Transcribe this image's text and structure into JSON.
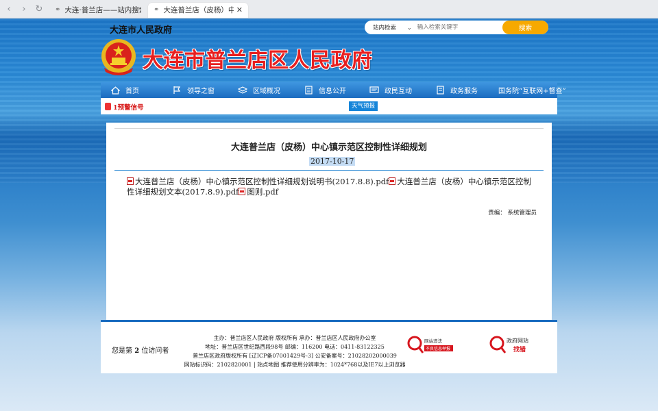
{
  "browser": {
    "tabs": [
      {
        "title": "大连·普兰店——站内搜索",
        "active": false
      },
      {
        "title": "大连普兰店（皮杨）中心镇示",
        "active": true
      }
    ],
    "close_glyph": "✕",
    "icons": [
      "back-icon",
      "forward-icon",
      "reload-icon"
    ]
  },
  "header": {
    "site_label": "大连市人民政府",
    "site_title": "大连市普兰店区人民政府",
    "search": {
      "scope": "站内检索",
      "placeholder": "输入检索关键字",
      "button": "搜索"
    }
  },
  "nav": {
    "items": [
      {
        "label": "首页",
        "icon": "home-icon"
      },
      {
        "label": "领导之窗",
        "icon": "flag-icon"
      },
      {
        "label": "区域概况",
        "icon": "map-icon"
      },
      {
        "label": "信息公开",
        "icon": "document-icon"
      },
      {
        "label": "政民互动",
        "icon": "chat-icon"
      },
      {
        "label": "政务服务",
        "icon": "service-icon"
      },
      {
        "label": "国务院“互联网+督查”",
        "icon": ""
      }
    ]
  },
  "alert": {
    "text": "1预警信号",
    "weather": "天气预报"
  },
  "article": {
    "title": "大连普兰店（皮杨）中心镇示范区控制性详细规划",
    "date": "2017-10-17",
    "attachments": [
      "大连普兰店（皮杨）中心镇示范区控制性详细规划说明书(2017.8.8).pdf",
      "大连普兰店（皮杨）中心镇示范区控制性详细规划文本(2017.8.9).pdf",
      "图则.pdf"
    ],
    "editor": "责编：  系统管理员"
  },
  "footer": {
    "visitors_prefix": "您是第",
    "visitors_count": "2",
    "visitors_suffix": "位访问者",
    "lines": [
      "主办：普兰店区人民政府 版权所有 承办：普兰店区人民政府办公室",
      "地址：普兰店区世纪路西段98号 邮编：116200 电话：0411-83122325",
      "普兰店区政府版权所有 [辽ICP备07001429号-3] 公安备案号：21028202000039",
      "网站标识码：2102820001 | 站点地图 推荐使用分辨率为：1024*768以及IE7以上浏览器"
    ],
    "badge1": {
      "line1": "网站违法",
      "line2": "不良信息举报"
    },
    "badge2": {
      "line1": "政府网站",
      "line2": "找错"
    }
  },
  "colors": {
    "accent": "#1a6cc0",
    "title_red": "#e81f1f",
    "search_button": "#f7a900",
    "nav_top": "#3f96e0",
    "nav_bottom": "#1b6cc0"
  }
}
